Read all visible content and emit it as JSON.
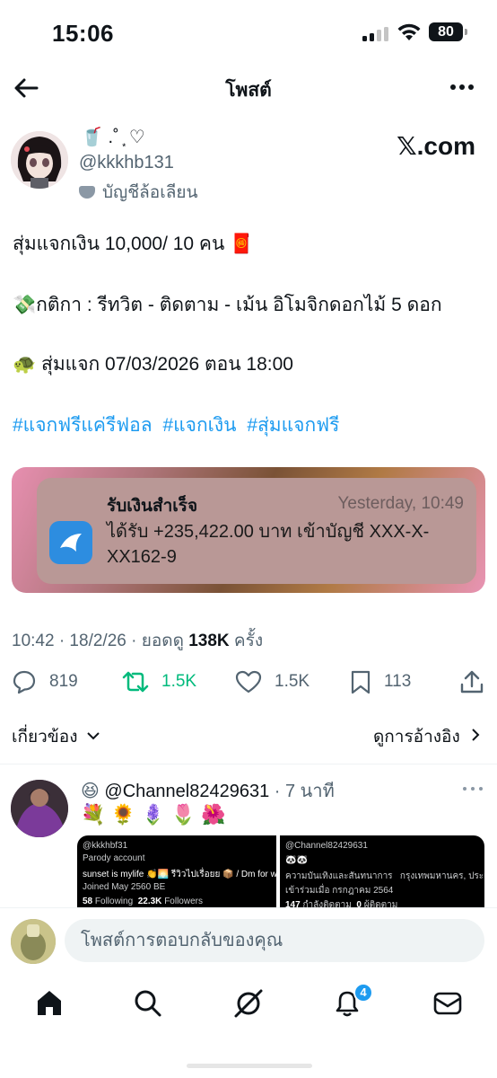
{
  "status_bar": {
    "time": "15:06",
    "battery": "80"
  },
  "header": {
    "title": "โพสต์",
    "back_icon": "arrow-left-icon",
    "more_icon": "more-dots-icon"
  },
  "post": {
    "author_name": "🥤 .˚ ͙ ♡",
    "handle": "@kkkhb131",
    "parody_label": "บัญชีล้อเลียน",
    "brand": "𝕏.com",
    "lines": [
      "สุ่มแจกเงิน 10,000/ 10  คน",
      "กติกา : รีทวิต - ติดตาม - เม้น อิโมจิกดอกไม้ 5 ดอก",
      "สุ่มแจก 07/03/2026 ตอน 18:00"
    ],
    "line_emojis": [
      "🧧",
      "💸",
      "🐢"
    ],
    "hashtags": [
      "#แจกฟรีแค่รีฟอล",
      "#แจกเงิน",
      "#สุ่มแจกฟรี"
    ],
    "media": {
      "notification_title": "รับเงินสำเร็จ",
      "notification_time": "Yesterday, 10:49",
      "notification_body": "ได้รับ +235,422.00 บาท เข้าบัญชี XXX-X-XX162-9"
    },
    "timestamp": "10:42 · 18/2/26 · ยอดดู ",
    "views": "138K",
    "views_suffix": " ครั้ง",
    "stats": {
      "replies": "819",
      "reposts": "1.5K",
      "likes": "1.5K",
      "bookmarks": "113"
    },
    "related_label": "เกี่ยวข้อง",
    "quotes_label": "ดูการอ้างอิง"
  },
  "reply": {
    "emoji": "😆",
    "handle": "@Channel82429631",
    "age": " · 7 นาที",
    "text": "💐 🌻 🪻 🌷 🌺",
    "media_left": {
      "handle": "@kkkhbf31",
      "label": "Parody account",
      "bio": "sunset is mylife 👏🌅 รีวิวไปเรื่อยย 📦 / Dm for work",
      "joined": "Joined May 2560 BE",
      "following": "58",
      "following_label": "Following",
      "followers": "22.3K",
      "followers_label": "Followers"
    },
    "media_right": {
      "handle": "@Channel82429631",
      "emoji": "🐼🐼",
      "category": "ความบันเทิงและสันทนาการ",
      "location": "กรุงเทพมหานคร, ประเทศไทย",
      "joined": "เข้าร่วมเมื่อ กรกฎาคม 2564",
      "following": "147",
      "following_label": "กำลังติดตาม",
      "followers": "0",
      "followers_label": "ผู้ติดตาม"
    }
  },
  "compose": {
    "placeholder": "โพสต์การตอบกลับของคุณ"
  },
  "tabbar": {
    "items": [
      "home-icon",
      "search-icon",
      "grok-icon",
      "notifications-icon",
      "messages-icon"
    ],
    "notifications_badge": "4"
  },
  "colors": {
    "accent": "#1d9bf0",
    "repost": "#00ba7c",
    "text": "#0f1419",
    "muted": "#536471"
  }
}
